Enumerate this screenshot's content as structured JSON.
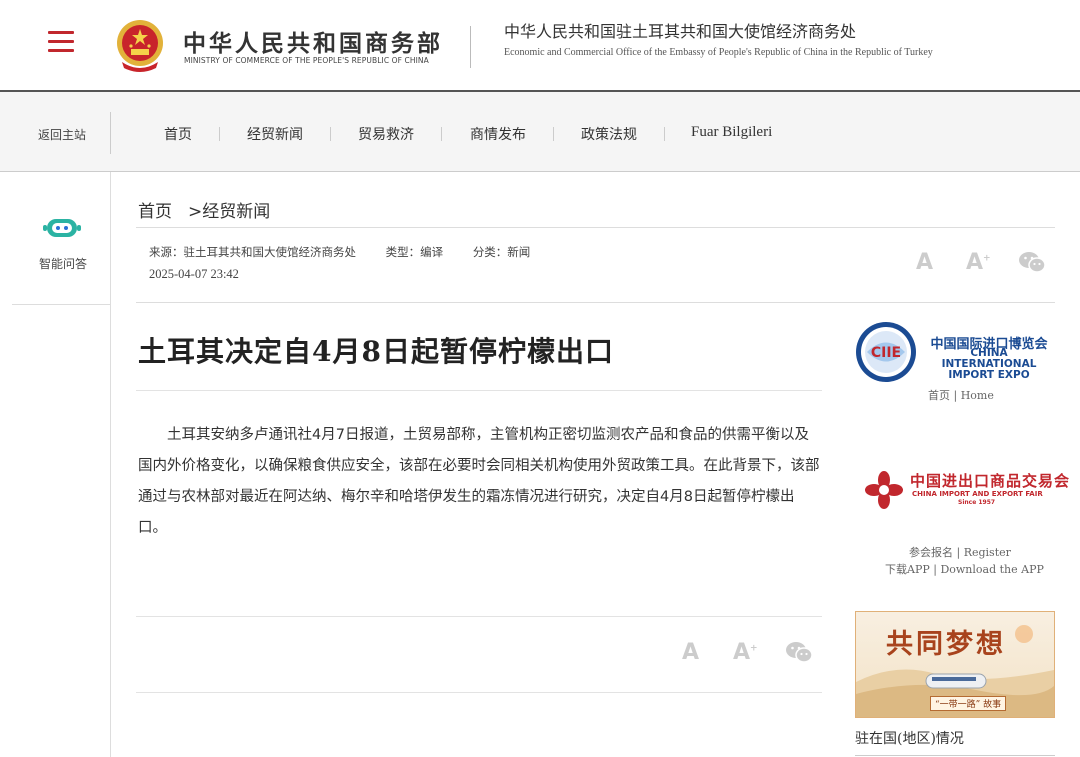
{
  "colors": {
    "accent": "#c1272d",
    "ciie_blue": "#1b4b93",
    "nav_bg": "#f5f5f5"
  },
  "header": {
    "ministry_cn": "中华人民共和国商务部",
    "ministry_en": "MINISTRY OF COMMERCE OF THE PEOPLE'S REPUBLIC OF CHINA",
    "office_cn": "中华人民共和国驻土耳其共和国大使馆经济商务处",
    "office_en": "Economic and Commercial Office of the Embassy of People's Republic of China in the Republic of Turkey",
    "menu_icon": "hamburger-menu-icon",
    "emblem_icon": "national-emblem-icon"
  },
  "nav": {
    "back_home": "返回主站",
    "items": [
      "首页",
      "经贸新闻",
      "贸易救济",
      "商情发布",
      "政策法规",
      "Fuar Bilgileri"
    ]
  },
  "left": {
    "ai_label": "智能问答",
    "ai_icon": "chatbot-icon"
  },
  "breadcrumb": {
    "home": "首页",
    "sep": ">",
    "current": "经贸新闻"
  },
  "meta": {
    "source": "来源：驻土耳其共和国大使馆经济商务处",
    "type": "类型：编译",
    "category": "分类：新闻",
    "date": "2025-04-07 23:42"
  },
  "tools": {
    "font_small": "A",
    "font_large": "A",
    "wechat_icon": "wechat-icon"
  },
  "article": {
    "title": "土耳其决定自4月8日起暂停柠檬出口",
    "body": "土耳其安纳多卢通讯社4月7日报道，土贸易部称，主管机构正密切监测农产品和食品的供需平衡以及国内外价格变化，以确保粮食供应安全，该部在必要时会同相关机构使用外贸政策工具。在此背景下，该部通过与农林部对最近在阿达纳、梅尔辛和哈塔伊发生的霜冻情况进行研究，决定自4月8日起暂停柠檬出口。"
  },
  "sidebar": {
    "ciie_logo_text": "CIIE",
    "ciie_cn": "中国国际进口博览会",
    "ciie_en_lines": [
      "CHINA INTERNATIONAL",
      "IMPORT EXPO"
    ],
    "ciie_link": "首页 | Home",
    "canton_cn": "中国进出口商品交易会",
    "canton_en": "CHINA IMPORT AND EXPORT FAIR",
    "canton_since": "Since 1957",
    "canton_register": "参会报名 | Register",
    "canton_download": "下载APP | Download the APP",
    "banner_title": "共同梦想",
    "banner_tag": "“一带一路” 故事",
    "region_label": "驻在国(地区)情况"
  }
}
